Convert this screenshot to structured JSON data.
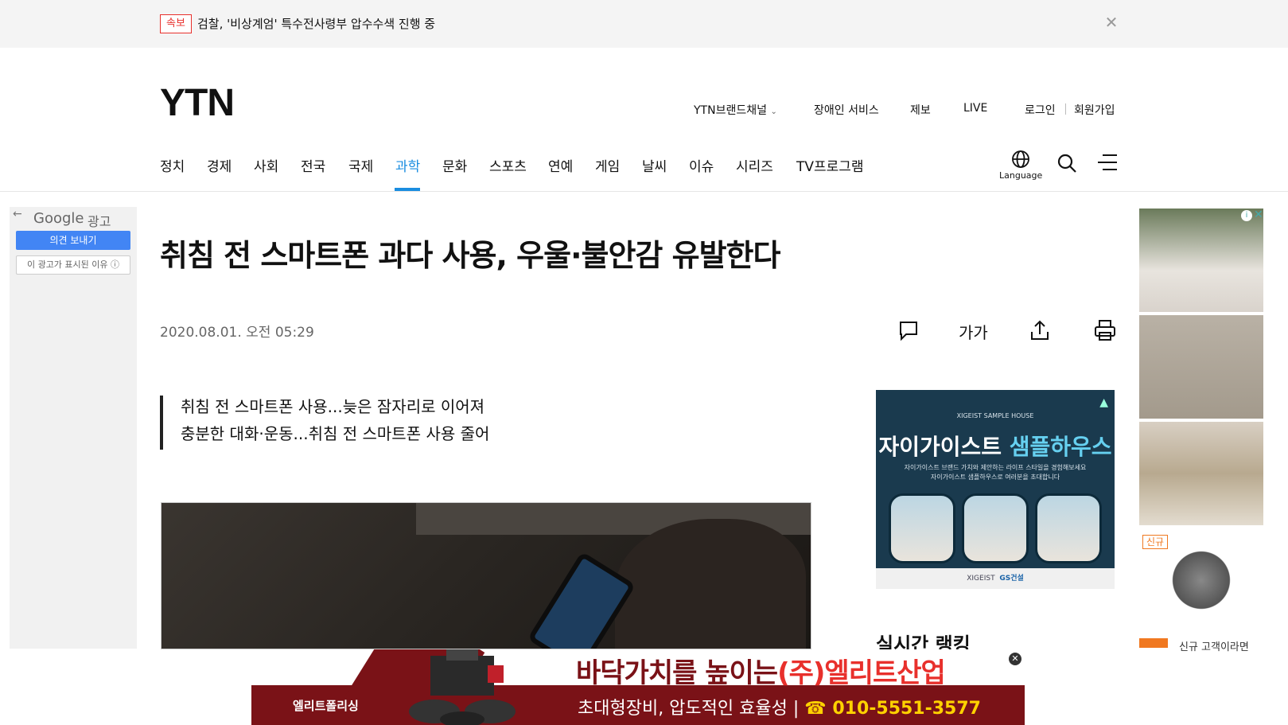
{
  "breaking": {
    "badge": "속보",
    "headline": "검찰, '비상계엄' 특수전사령부 압수수색 진행 중",
    "close_icon": "close-icon"
  },
  "header": {
    "logo": "YTN",
    "util": {
      "brand_channel": "YTN브랜드채널",
      "accessibility": "장애인 서비스",
      "report": "제보",
      "live": "LIVE",
      "login": "로그인",
      "signup": "회원가입"
    },
    "nav": [
      "정치",
      "경제",
      "사회",
      "전국",
      "국제",
      "과학",
      "문화",
      "스포츠",
      "연예",
      "게임",
      "날씨",
      "이슈",
      "시리즈",
      "TV프로그램"
    ],
    "active_nav": "과학",
    "language_label": "Language",
    "accent_color": "#1a8de0"
  },
  "left_ad": {
    "back_icon": "back-arrow-icon",
    "brand": "Google",
    "ad_word": "광고",
    "feedback": "의견 보내기",
    "why": "이 광고가 표시된 이유 ⓘ"
  },
  "article": {
    "title": "취침 전 스마트폰 과다 사용, 우울·불안감 유발한다",
    "date": "2020.08.01. 오전 05:29",
    "font_size_label": "가가",
    "summary": [
      "취침 전 스마트폰 사용...늦은 잠자리로 이어져",
      "충분한 대화·운동...취침 전 스마트폰 사용 줄어"
    ]
  },
  "right_ad": {
    "tag": "XIGEIST SAMPLE HOUSE",
    "head_white": "자이가이스트 ",
    "head_blue": "샘플하우스",
    "sub1": "자이가이스트 브랜드 가치와 제안하는 라이프 스타일을 경험해보세요",
    "sub2": "자이가이스트 샘플하우스로 여러분을 초대합니다",
    "footer_a": "XIGEIST",
    "footer_b": "GS건설"
  },
  "ranking_title": "실시간 랭킹",
  "side_rail": {
    "new_badge": "신규",
    "caption": "신규 고객이라면"
  },
  "bottom_ad": {
    "brand": "엘리트폴리싱",
    "head_black": "바닥가치를 높이는",
    "head_red": "(주)엘리트산업",
    "line_text": "초대형장비, 압도적인 효율성 | ",
    "phone": "☎ 010-5551-3577"
  }
}
